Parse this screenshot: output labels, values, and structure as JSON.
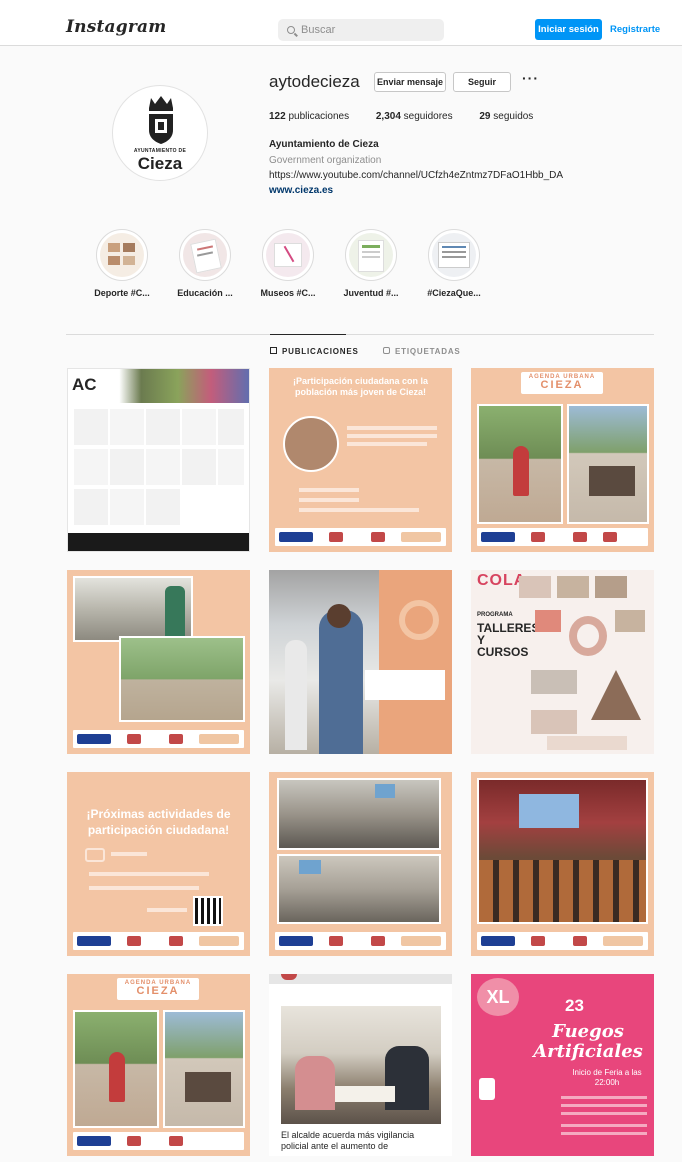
{
  "header": {
    "logo_text": "Instagram",
    "search_placeholder": "Buscar",
    "login_label": "Iniciar sesión",
    "signup_label": "Registrarte"
  },
  "profile": {
    "username": "aytodecieza",
    "message_button": "Enviar mensaje",
    "follow_button": "Seguir",
    "more_icon": "more-horizontal-icon",
    "stats": {
      "posts_count": "122",
      "posts_label": "publicaciones",
      "followers_count": "2,304",
      "followers_label": "seguidores",
      "following_count": "29",
      "following_label": "seguidos"
    },
    "full_name": "Ayuntamiento de Cieza",
    "category": "Government organization",
    "bio_url": "https://www.youtube.com/channel/UCfzh4eZntmz7DFaO1Hbb_DA",
    "website": "www.cieza.es",
    "avatar_text_small": "AYUNTAMIENTO DE",
    "avatar_text_big": "Cieza"
  },
  "highlights": [
    {
      "label": "Deporte #C..."
    },
    {
      "label": "Educación ..."
    },
    {
      "label": "Museos #C..."
    },
    {
      "label": "Juventud #..."
    },
    {
      "label": "#CiezaQue..."
    }
  ],
  "tabs": [
    {
      "label": "PUBLICACIONES",
      "icon": "grid-icon",
      "active": true
    },
    {
      "label": "ETIQUETADAS",
      "icon": "tag-icon",
      "active": false
    }
  ],
  "posts": {
    "p1": {
      "big": "AC",
      "small": "C"
    },
    "p2": {
      "title": "¡Participación ciudadana con la población más joven de Cieza!"
    },
    "p3": {
      "agenda": "AGENDA URBANA",
      "city": "CIEZA"
    },
    "p6": {
      "word1": "COLA",
      "programa": "PROGRAMA",
      "talleres": "TALLERES Y CURSOS"
    },
    "p7": {
      "title": "¡Próximas actividades de participación ciudadana!"
    },
    "p10": {
      "agenda": "AGENDA URBANA",
      "city": "CIEZA"
    },
    "p11": {
      "caption": "El alcalde acuerda más vigilancia policial ante el aumento de"
    },
    "p12": {
      "badge": "XL",
      "day": "23",
      "title": "Fuegos Artificiales",
      "sub": "Inicio de Feria a las 22:00h"
    }
  },
  "colors": {
    "accent": "#0095f6",
    "peach": "#f3c5a4",
    "pink": "#e8467c"
  }
}
